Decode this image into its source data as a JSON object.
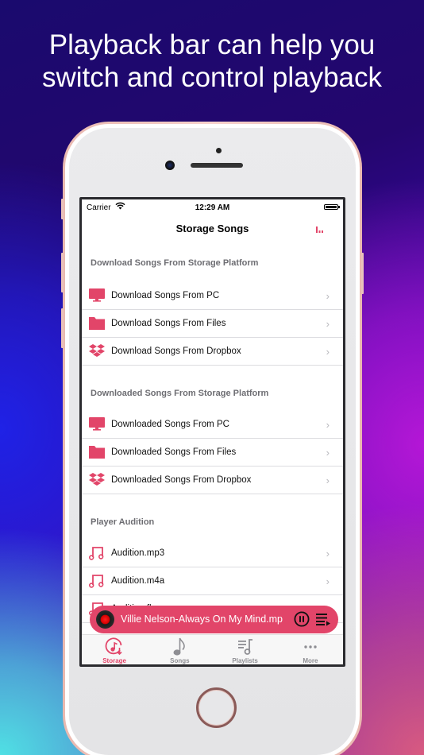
{
  "headline": {
    "line1": "Playback bar can help you",
    "line2": "switch and control playback"
  },
  "colors": {
    "accent": "#e24569",
    "section_text": "#6d6d72",
    "tab_inactive": "#8e8e93"
  },
  "status_bar": {
    "carrier": "Carrier",
    "time": "12:29 AM"
  },
  "nav": {
    "title": "Storage Songs",
    "right_icon": "equalizer-icon"
  },
  "sections": [
    {
      "header": "Download Songs From Storage Platform",
      "rows": [
        {
          "icon": "monitor-icon",
          "label": "Download Songs From PC"
        },
        {
          "icon": "folder-icon",
          "label": "Download Songs From Files"
        },
        {
          "icon": "dropbox-icon",
          "label": "Download Songs From Dropbox"
        }
      ]
    },
    {
      "header": "Downloaded Songs From Storage Platform",
      "rows": [
        {
          "icon": "monitor-icon",
          "label": "Downloaded Songs From PC"
        },
        {
          "icon": "folder-icon",
          "label": "Downloaded Songs From Files"
        },
        {
          "icon": "dropbox-icon",
          "label": "Downloaded Songs From Dropbox"
        }
      ]
    },
    {
      "header": "Player Audition",
      "rows": [
        {
          "icon": "music-note-icon",
          "label": "Audition.mp3"
        },
        {
          "icon": "music-note-icon",
          "label": "Audition.m4a"
        },
        {
          "icon": "music-note-icon",
          "label": "Audition.flac"
        }
      ]
    }
  ],
  "playback_bar": {
    "now_playing": "Villie Nelson-Always On My Mind.mp",
    "pause_icon": "pause-circle-icon",
    "queue_icon": "queue-list-icon"
  },
  "tabs": [
    {
      "label": "Storage",
      "icon": "storage-download-icon",
      "active": true
    },
    {
      "label": "Songs",
      "icon": "music-note-icon",
      "active": false
    },
    {
      "label": "Playlists",
      "icon": "playlist-icon",
      "active": false
    },
    {
      "label": "More",
      "icon": "more-icon",
      "active": false
    }
  ]
}
